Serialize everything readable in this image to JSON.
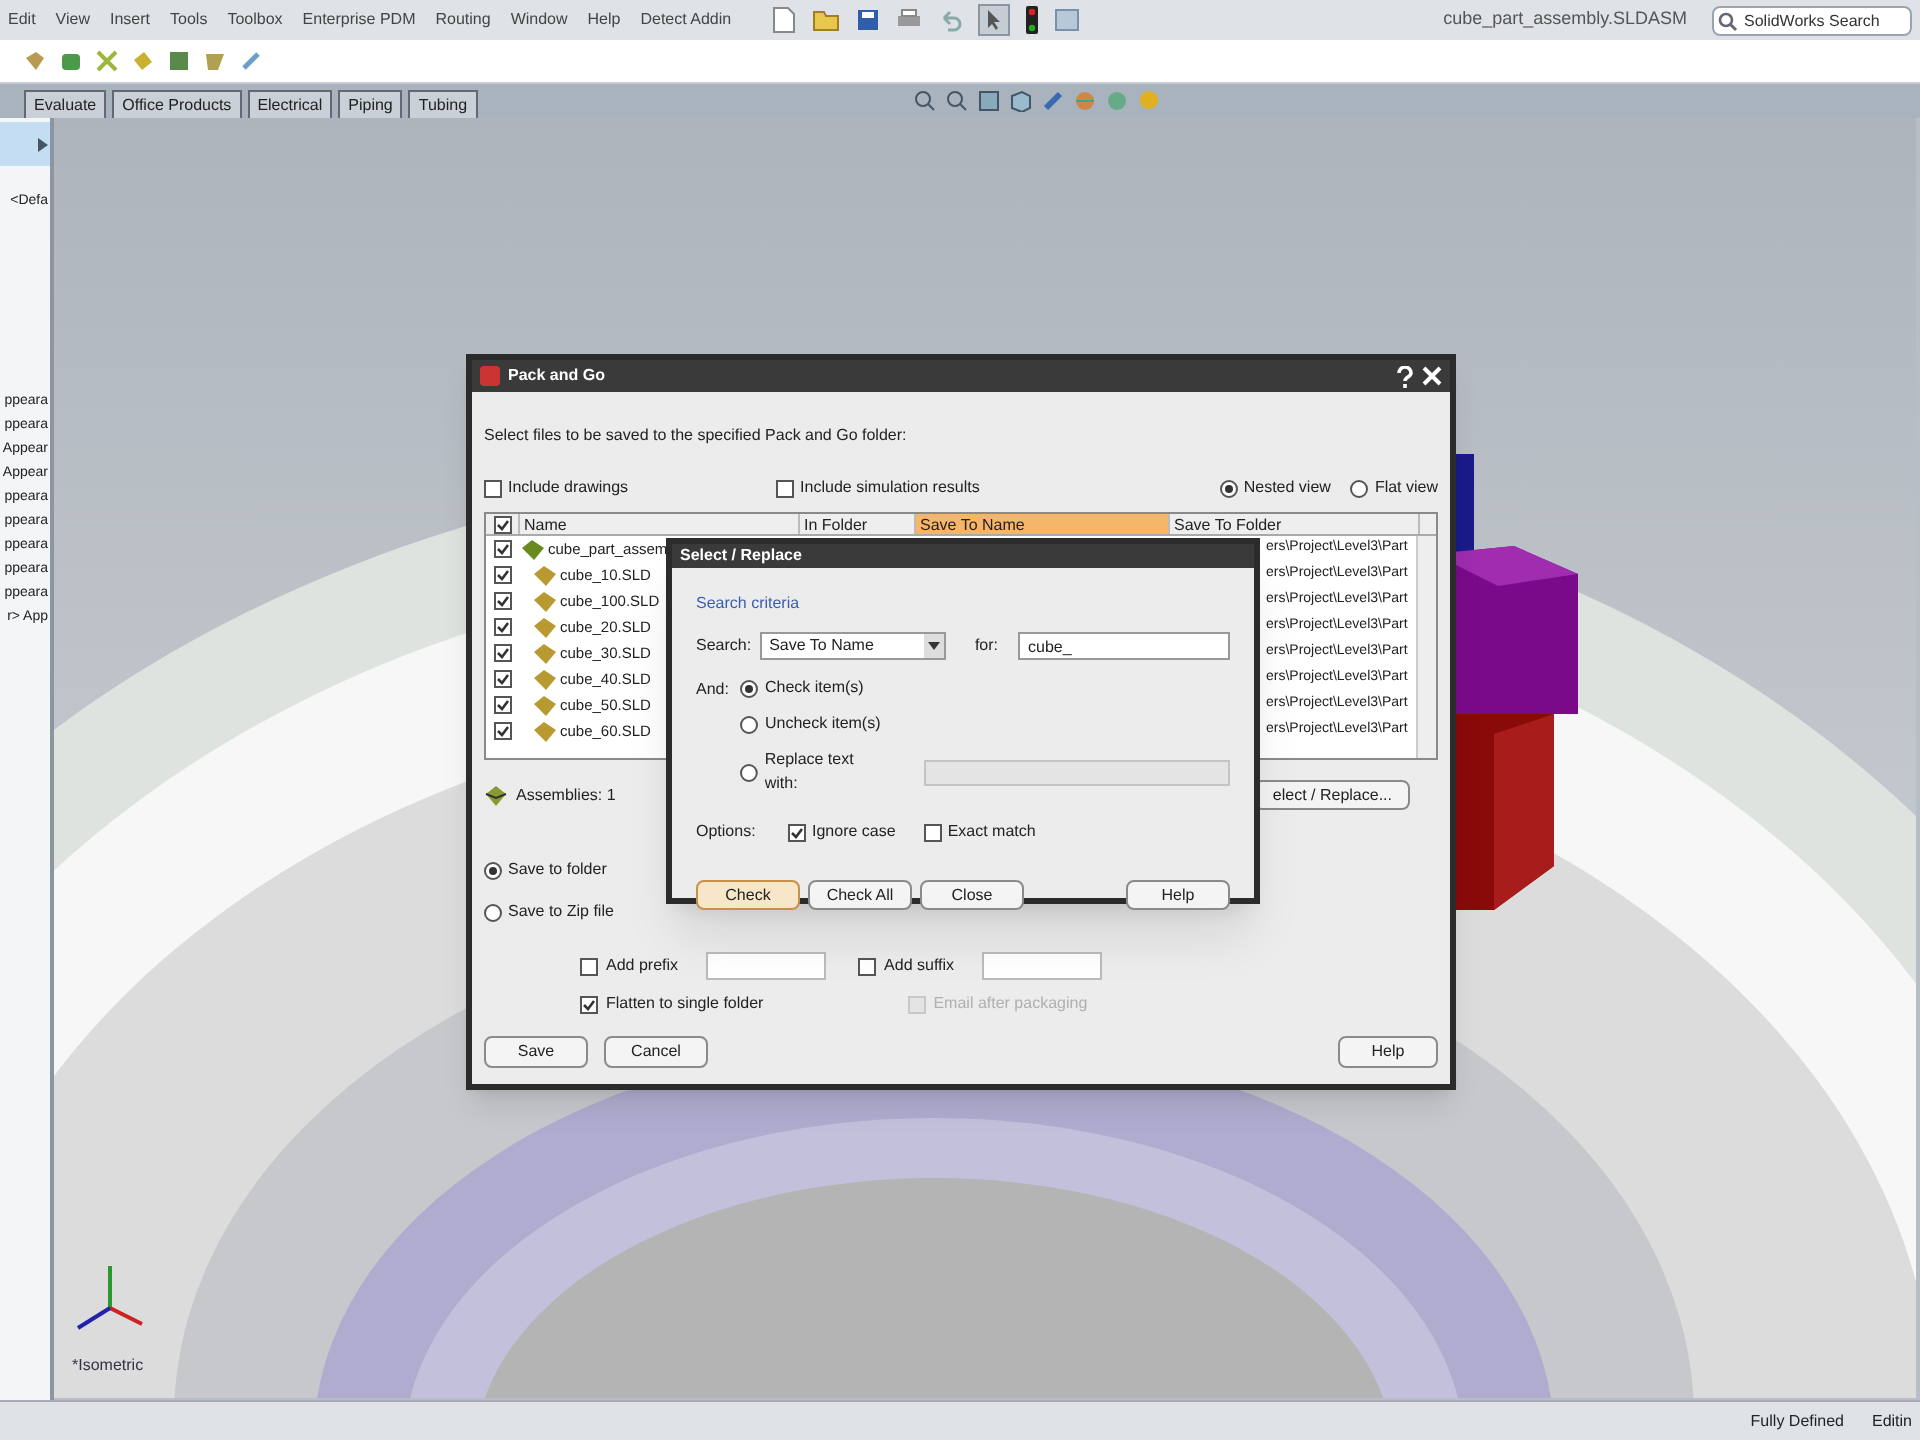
{
  "menu": [
    "Edit",
    "View",
    "Insert",
    "Tools",
    "Toolbox",
    "Enterprise PDM",
    "Routing",
    "Window",
    "Help",
    "Detect Addin"
  ],
  "window": {
    "title": "cube_part_assembly.SLDASM"
  },
  "search": {
    "placeholder": "SolidWorks Search"
  },
  "tabs": [
    {
      "label": "Evaluate",
      "selected": false
    },
    {
      "label": "Office Products",
      "selected": false
    },
    {
      "label": "Electrical",
      "selected": false
    },
    {
      "label": "Piping",
      "selected": false
    },
    {
      "label": "Tubing",
      "selected": false
    }
  ],
  "left_panel": {
    "items": [
      "<Defa",
      "ppeara",
      "ppeara",
      "Appear",
      "Appear",
      "ppeara",
      "ppeara",
      "ppeara",
      "ppeara",
      "ppeara",
      "r> App"
    ]
  },
  "viewport": {
    "view_label": "*Isometric"
  },
  "status_bar": [
    "Fully Defined",
    "Editin"
  ],
  "pack_and_go": {
    "title": "Pack and Go",
    "instruction": "Select files to be saved to the specified Pack and Go folder:",
    "options": [
      {
        "label": "Include drawings",
        "checked": false
      },
      {
        "label": "Include simulation results",
        "checked": false
      }
    ],
    "views": [
      {
        "label": "Nested view",
        "selected": true
      },
      {
        "label": "Flat view",
        "selected": false
      }
    ],
    "columns": [
      {
        "label": "Name",
        "selected": false
      },
      {
        "label": "In Folder",
        "selected": false
      },
      {
        "label": "Save To Name",
        "selected": true
      },
      {
        "label": "Save To Folder",
        "selected": false
      }
    ],
    "rows": [
      {
        "name": "cube_part_assem",
        "folder": "ers\\Project\\Level3\\Part",
        "checked": true,
        "kind": "assembly"
      },
      {
        "name": "cube_10.SLD",
        "folder": "ers\\Project\\Level3\\Part",
        "checked": true,
        "kind": "part"
      },
      {
        "name": "cube_100.SLD",
        "folder": "ers\\Project\\Level3\\Part",
        "checked": true,
        "kind": "part"
      },
      {
        "name": "cube_20.SLD",
        "folder": "ers\\Project\\Level3\\Part",
        "checked": true,
        "kind": "part"
      },
      {
        "name": "cube_30.SLD",
        "folder": "ers\\Project\\Level3\\Part",
        "checked": true,
        "kind": "part"
      },
      {
        "name": "cube_40.SLD",
        "folder": "ers\\Project\\Level3\\Part",
        "checked": true,
        "kind": "part"
      },
      {
        "name": "cube_50.SLD",
        "folder": "ers\\Project\\Level3\\Part",
        "checked": true,
        "kind": "part"
      },
      {
        "name": "cube_60.SLD",
        "folder": "ers\\Project\\Level3\\Part",
        "checked": true,
        "kind": "part"
      }
    ],
    "summary": "Assemblies: 1",
    "select_replace_button": "elect / Replace...",
    "destinations": [
      {
        "label": "Save to folder",
        "selected": true
      },
      {
        "label": "Save to Zip file",
        "selected": false
      }
    ],
    "prefix": {
      "label": "Add prefix",
      "checked": false
    },
    "suffix": {
      "label": "Add suffix",
      "checked": false
    },
    "flatten": {
      "label": "Flatten to single folder",
      "checked": true
    },
    "email": {
      "label": "Email after packaging",
      "checked": false,
      "disabled": true
    },
    "buttons": [
      "Save",
      "Cancel"
    ],
    "help": "Help"
  },
  "select_replace": {
    "title": "Select / Replace",
    "group": "Search criteria",
    "search_label": "Search:",
    "search_value": "Save To Name",
    "for_label": "for:",
    "for_value": "cube_",
    "and_label": "And:",
    "actions": [
      {
        "label": "Check item(s)",
        "selected": true
      },
      {
        "label": "Uncheck item(s)",
        "selected": false
      },
      {
        "label": "Replace text with:",
        "selected": false
      }
    ],
    "options_label": "Options:",
    "option_checks": [
      {
        "label": "Ignore case",
        "checked": true
      },
      {
        "label": "Exact match",
        "checked": false
      }
    ],
    "buttons": [
      {
        "label": "Check",
        "selected": true
      },
      {
        "label": "Check All",
        "selected": false
      },
      {
        "label": "Close",
        "selected": false
      }
    ],
    "help": "Help"
  }
}
